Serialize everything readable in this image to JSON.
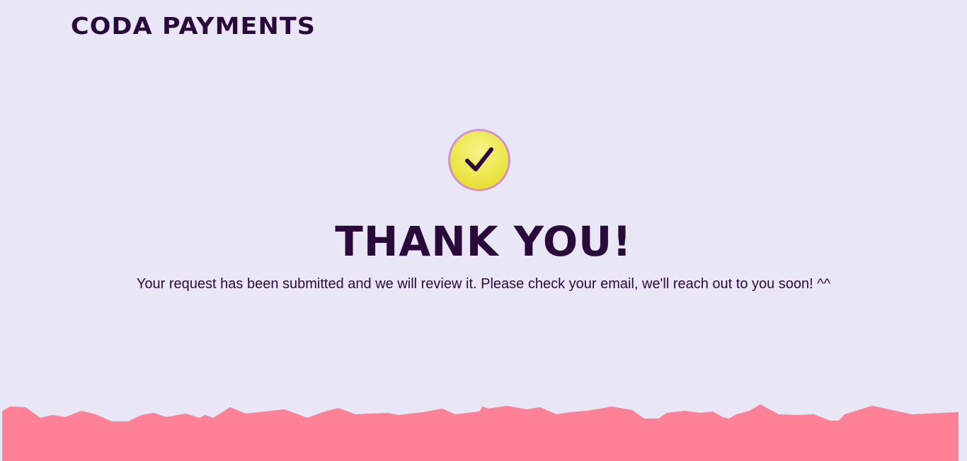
{
  "header": {
    "logo_text": "CODA PAYMENTS"
  },
  "main": {
    "icon": "checkmark-icon",
    "title": "THANK YOU!",
    "message": "Your request has been submitted and we will review it. Please check your email, we'll reach out to you soon! ^^"
  },
  "colors": {
    "background": "#e9e6f6",
    "text": "#2a0a3a",
    "badge_yellow": "#ece74a",
    "footer_pink": "#ff8197"
  }
}
